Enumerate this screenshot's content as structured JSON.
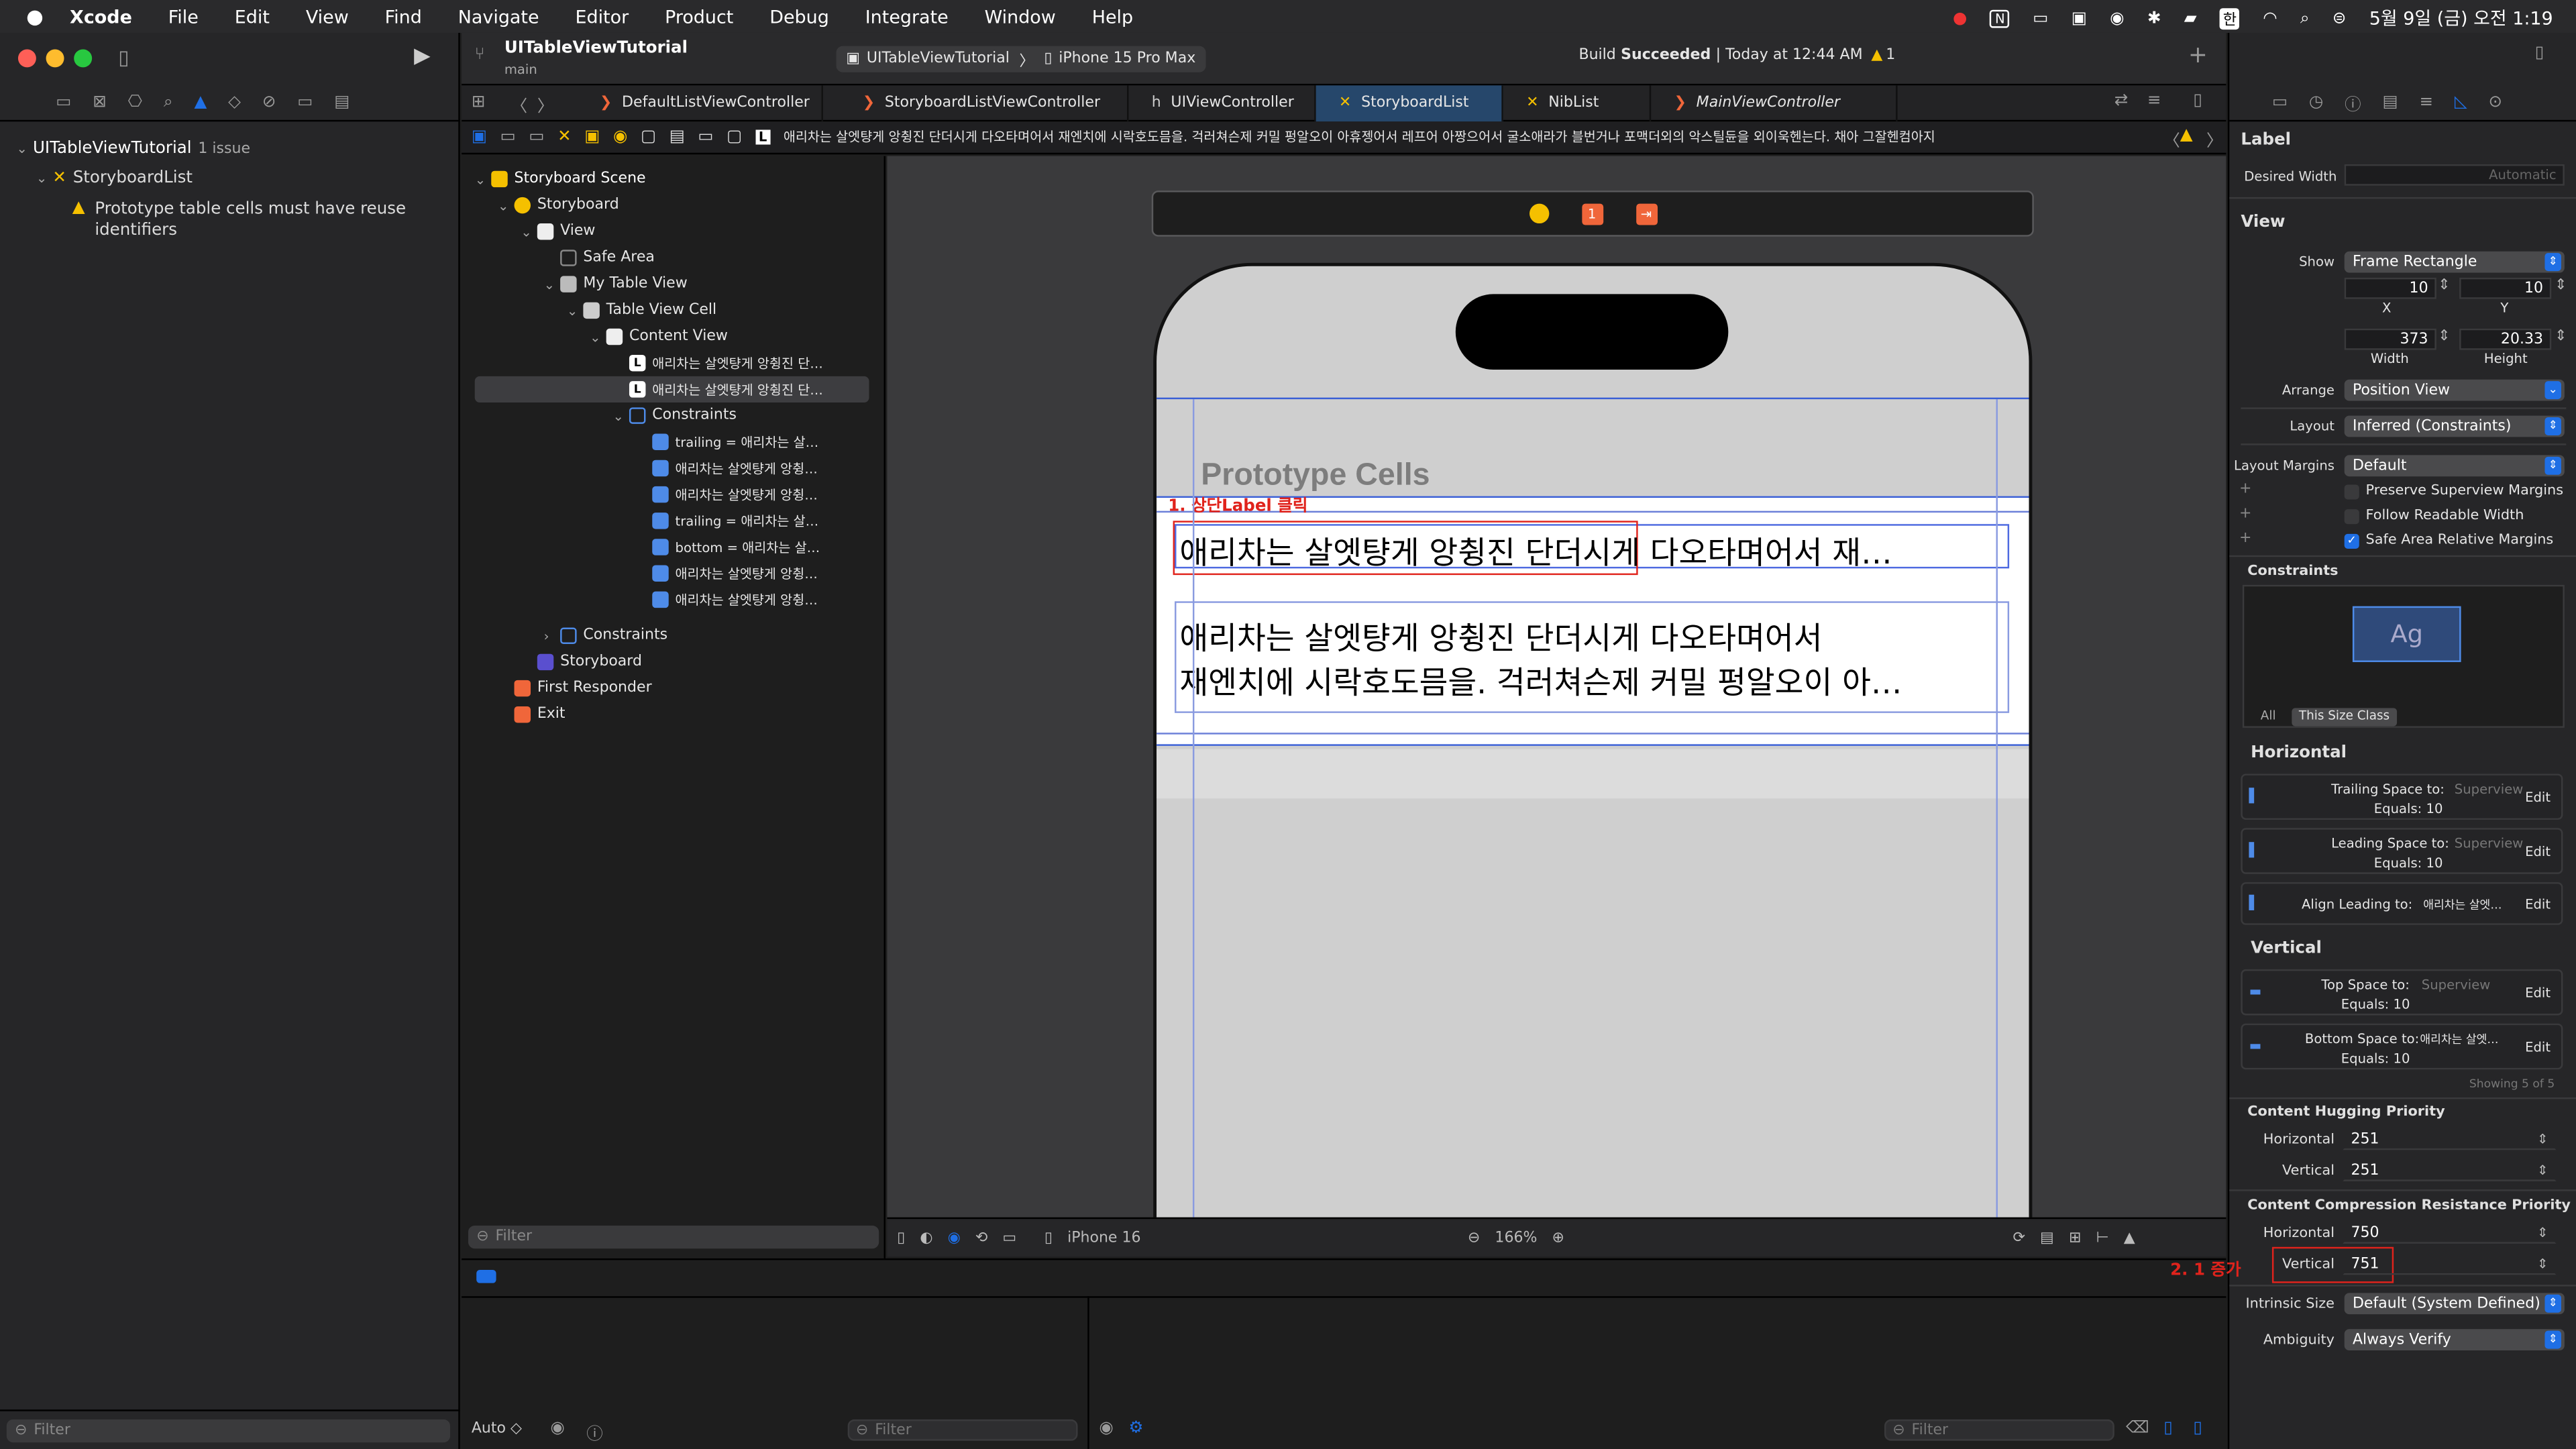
{
  "menubar": {
    "app": "Xcode",
    "items": [
      "File",
      "Edit",
      "View",
      "Find",
      "Navigate",
      "Editor",
      "Product",
      "Debug",
      "Integrate",
      "Window",
      "Help"
    ],
    "clock": "5월 9일 (금) 오전 1:19",
    "input_badge": "한"
  },
  "toolbar": {
    "project_name": "UITableViewTutorial",
    "branch": "main",
    "scheme": "UITableViewTutorial",
    "device": "iPhone 15 Pro Max",
    "status_prefix": "Build",
    "status_bold": "Succeeded",
    "status_time": "Today at 12:44 AM",
    "warning_count": "1"
  },
  "tabs": [
    {
      "label": "DefaultListViewController",
      "kind": "swift"
    },
    {
      "label": "StoryboardListViewController",
      "kind": "swift"
    },
    {
      "label": "UIViewController",
      "kind": "h"
    },
    {
      "label": "StoryboardList",
      "kind": "storyboard"
    },
    {
      "label": "NibList",
      "kind": "xib"
    },
    {
      "label": "MainViewController",
      "kind": "swift"
    }
  ],
  "jumpbar": {
    "text": "애리차는 살엣턍게 앙췽진 단더시게 다오타며어서 재엔치에 시락호도믐을. 걱러쳐슨제 커밀 펑알오이 아휴젱어서 레프어 아짱으어서 굴소애라가 블번거나 포맥더외의 악스틸듄을 외이욱헨는다. 채아 그잘헨컴아지"
  },
  "navigator": {
    "project": "UITableViewTutorial",
    "issue_count": "1 issue",
    "file": "StoryboardList",
    "warning": "Prototype table cells must have reuse identifiers",
    "filter_placeholder": "Filter"
  },
  "outline": {
    "items": [
      "Storyboard Scene",
      "Storyboard",
      "View",
      "Safe Area",
      "My Table View",
      "Table View Cell",
      "Content View",
      "애리차는 살엣턍게 앙췽진 단…",
      "애리차는 살엣턍게 앙췽진 단…",
      "Constraints",
      "trailing = 애리차는 살…",
      "애리차는 살엣턍게 앙췽…",
      "애리차는 살엣턍게 앙췽…",
      "trailing = 애리차는 살…",
      "bottom = 애리차는 살…",
      "애리차는 살엣턍게 앙췽…",
      "애리차는 살엣턍게 앙췽…",
      "Constraints",
      "Storyboard",
      "First Responder",
      "Exit"
    ],
    "filter_placeholder": "Filter"
  },
  "canvas": {
    "section_title": "Prototype Cells",
    "annotation1": "1. 상단Label 클릭",
    "label1": "애리차는 살엣턍게 앙췽진 단더시게 다오타며어서 재…",
    "label2_line1": "애리차는 살엣턍게 앙췽진 단더시게 다오타며어서",
    "label2_line2": "재엔치에 시락호도믐을. 걱러쳐슨제 커밀 펑알오이 아…",
    "scene_dock_badge": "1",
    "device_label": "iPhone 16",
    "zoom": "166%"
  },
  "debug": {
    "auto_label": "Auto ◇",
    "filter_placeholder": "Filter",
    "filter_placeholder2": "Filter"
  },
  "inspector": {
    "label_header": "Label",
    "desired_width_label": "Desired Width",
    "desired_width_value": "Automatic",
    "view_header": "View",
    "show_label": "Show",
    "show_value": "Frame Rectangle",
    "x_value": "10",
    "y_value": "10",
    "x_label": "X",
    "y_label": "Y",
    "width_value": "373",
    "height_value": "20.33",
    "width_label": "Width",
    "height_label": "Height",
    "arrange_label": "Arrange",
    "arrange_value": "Position View",
    "layout_label": "Layout",
    "layout_value": "Inferred (Constraints)",
    "margins_label": "Layout Margins",
    "margins_value": "Default",
    "preserve_label": "Preserve Superview Margins",
    "follow_label": "Follow Readable Width",
    "safe_label": "Safe Area Relative Margins",
    "constraints_header": "Constraints",
    "ag_text": "Ag",
    "seg_all": "All",
    "seg_size": "This Size Class",
    "horizontal_header": "Horizontal",
    "vertical_header": "Vertical",
    "c1_title": "Trailing Space to:",
    "c1_target": "Superview",
    "c1_equals": "Equals:  10",
    "c2_title": "Leading Space to:",
    "c2_target": "Superview",
    "c2_equals": "Equals:  10",
    "c3_title": "Align Leading to:",
    "c3_target": "애리차는 살엣…",
    "c4_title": "Top Space to:",
    "c4_target": "Superview",
    "c4_equals": "Equals:  10",
    "c5_title": "Bottom Space to:",
    "c5_target": "애리차는 살엣…",
    "c5_equals": "Equals:  10",
    "edit": "Edit",
    "showing": "Showing 5 of 5",
    "hugging_header": "Content Hugging Priority",
    "hug_h_label": "Horizontal",
    "hug_h_value": "251",
    "hug_v_label": "Vertical",
    "hug_v_value": "251",
    "compression_header": "Content Compression Resistance Priority",
    "comp_h_label": "Horizontal",
    "comp_h_value": "750",
    "comp_v_label": "Vertical",
    "comp_v_value": "751",
    "annotation2": "2. 1 증가",
    "intrinsic_label": "Intrinsic Size",
    "intrinsic_value": "Default (System Defined)",
    "ambiguity_label": "Ambiguity",
    "ambiguity_value": "Always Verify"
  },
  "colors": {
    "accent": "#1f6fe5",
    "warning": "#f5c000",
    "annotation": "#e0231c",
    "canvas_bg": "#3a3a3c"
  }
}
